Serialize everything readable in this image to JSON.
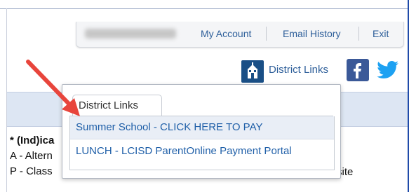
{
  "top_nav": {
    "links": [
      {
        "label": "My Account"
      },
      {
        "label": "Email History"
      },
      {
        "label": "Exit"
      }
    ]
  },
  "district_links": {
    "label": "District Links"
  },
  "dropdown": {
    "tab_label": "District Links",
    "items": [
      {
        "label": "Summer School - CLICK HERE TO PAY"
      },
      {
        "label": "LUNCH - LCISD ParentOnline Payment Portal"
      }
    ]
  },
  "legend": {
    "line1_bold": "* (Ind)ica",
    "line2": "A - Altern",
    "line3": "P - Class",
    "site_text": "site"
  },
  "colors": {
    "link": "#2e5f9a",
    "arrow": "#e8453c",
    "facebook": "#3b5998",
    "twitter": "#1da1f2"
  }
}
